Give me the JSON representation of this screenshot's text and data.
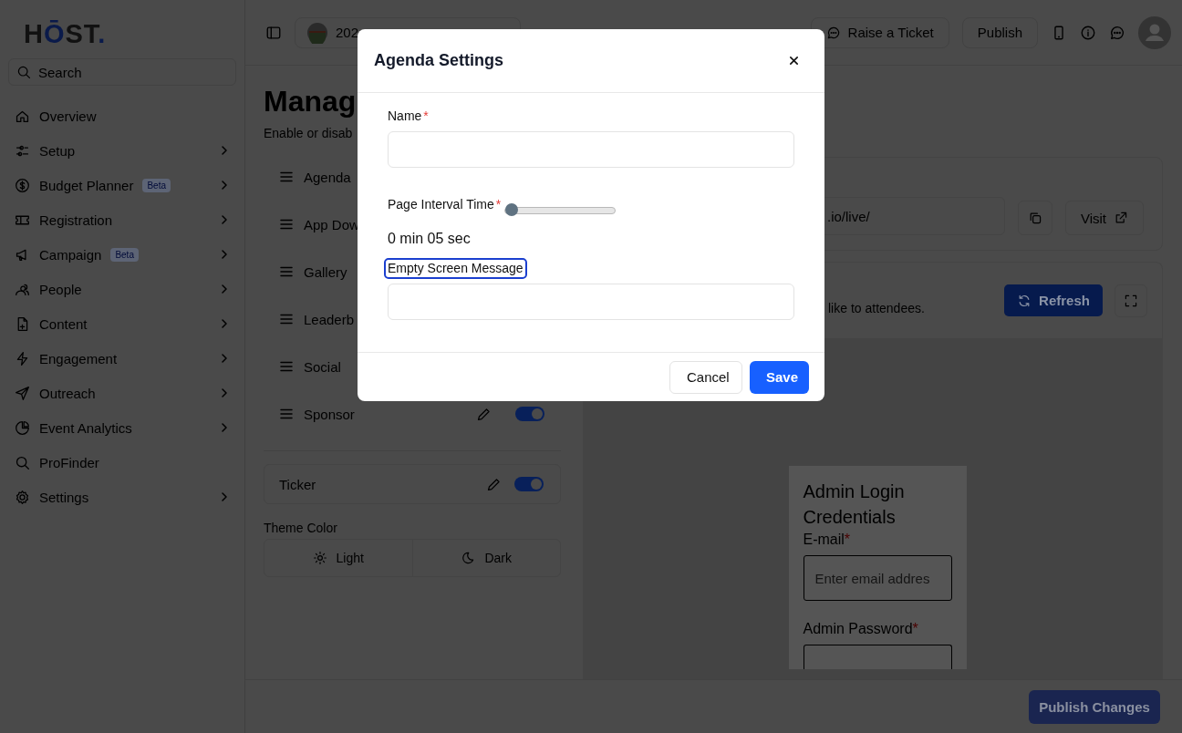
{
  "logo": {
    "parts": [
      {
        "text": "H",
        "color": "#111111"
      },
      {
        "text": "Ō",
        "color": "#0a1a4a"
      },
      {
        "text": "ST",
        "color": "#111111"
      },
      {
        "text": ".",
        "color": "#0a1a4a"
      }
    ]
  },
  "sidebar": {
    "search": {
      "placeholder": "Search"
    },
    "items": [
      {
        "label": "Overview",
        "chevron": false
      },
      {
        "label": "Setup",
        "chevron": true
      },
      {
        "label": "Budget Planner",
        "badge": "Beta",
        "chevron": true
      },
      {
        "label": "Registration",
        "chevron": true
      },
      {
        "label": "Campaign",
        "badge": "Beta",
        "chevron": true
      },
      {
        "label": "People",
        "chevron": true
      },
      {
        "label": "Content",
        "chevron": true
      },
      {
        "label": "Engagement",
        "chevron": true
      },
      {
        "label": "Outreach",
        "chevron": true
      },
      {
        "label": "Event Analytics",
        "chevron": true
      },
      {
        "label": "ProFinder",
        "chevron": false
      },
      {
        "label": "Settings",
        "chevron": true
      }
    ]
  },
  "topbar": {
    "event": "202",
    "buttons": [
      {
        "label": "Raise a Ticket"
      },
      {
        "label": "Publish"
      }
    ]
  },
  "page": {
    "title": "Manag",
    "subtitle": "Enable or disab",
    "modules": [
      {
        "label": "Agenda"
      },
      {
        "label": "App Dow"
      },
      {
        "label": "Gallery"
      },
      {
        "label": "Leaderb"
      },
      {
        "label": "Social"
      },
      {
        "label": "Sponsor",
        "on": true
      }
    ],
    "ticker": {
      "label": "Ticker",
      "on": true
    },
    "theme": {
      "label": "Theme Color",
      "options": [
        {
          "label": "Light",
          "selected": false
        },
        {
          "label": "Dark",
          "selected": false
        }
      ]
    }
  },
  "live": {
    "url": ".io/live/",
    "visit": "Visit"
  },
  "preview": {
    "text": "like to attendees.",
    "refresh": "Refresh",
    "card": {
      "title": "Admin Login Credentials",
      "fields": [
        {
          "label": "E-mail",
          "required": "*",
          "placeholder": "Enter email addres"
        },
        {
          "label": "Admin Password",
          "required": "*"
        }
      ]
    }
  },
  "footer": {
    "button": "Publish Changes"
  },
  "modal": {
    "title": "Agenda Settings",
    "fields": [
      {
        "kind": "text",
        "label": "Name",
        "required": "*",
        "focused": false
      },
      {
        "kind": "slider",
        "label": "Page Interval Time",
        "required": "*",
        "level": 0,
        "reading": "0 min 05 sec"
      },
      {
        "kind": "text",
        "label": "Empty Screen Message",
        "focused": true
      }
    ],
    "buttons": [
      {
        "label": "Cancel",
        "kind": "secondary"
      },
      {
        "label": "Save",
        "kind": "primary"
      }
    ]
  }
}
